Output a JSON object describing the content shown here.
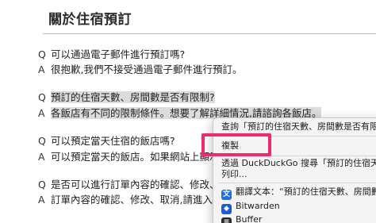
{
  "page": {
    "title": "關於住宿預訂"
  },
  "faq": [
    {
      "q_mark": "Q",
      "q": "可以通過電子郵件進行預訂嗎?",
      "a_mark": "A",
      "a": "很抱歉,我們不接受通過電子郵件進行預訂。"
    },
    {
      "q_mark": "Q",
      "q": "預訂的住宿天數、房間數是否有限制?",
      "a_mark": "A",
      "a": "各飯店有不同的限制條件。想要了解詳細情況,請諮詢各飯店。"
    },
    {
      "q_mark": "Q",
      "q": "可以預定當天住宿的飯店嗎?",
      "a_mark": "A",
      "a": "可以預定當天的飯店。如果網站上顯示"
    },
    {
      "q_mark": "Q",
      "q": "是否可以進行訂單內容的確認、修改、",
      "a_mark": "A",
      "a": "訂單內容的確認、修改、取消,請進入"
    }
  ],
  "context_menu": {
    "lookup": "查詢「預訂的住宿天數、房間數是否有限制?」",
    "copy": "複製",
    "search_line1": "透過 DuckDuckGo 搜尋「預訂的住宿天數、房間數是否有限",
    "search_line2": "列印...",
    "translate": "翻譯文本：“預訂的住宿天數、房間數是否有限",
    "bitwarden": "Bitwarden",
    "buffer": "Buffer"
  },
  "colors": {
    "highlight_box": "#ee2a6e",
    "selection": "#dcdcdc"
  }
}
